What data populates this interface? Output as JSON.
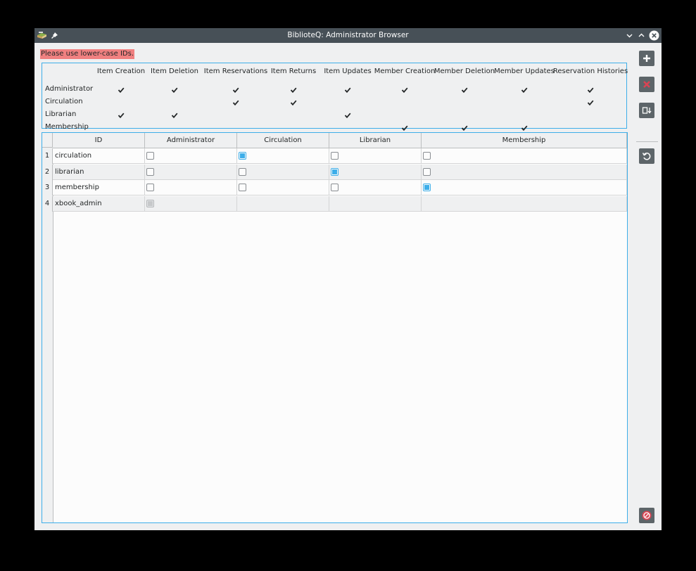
{
  "window": {
    "title": "BiblioteQ: Administrator Browser"
  },
  "warning": {
    "text": "Please use lower-case IDs."
  },
  "permissions": {
    "columns": [
      "Item Creation",
      "Item Deletion",
      "Item Reservations",
      "Item Returns",
      "Item Updates",
      "Member Creation",
      "Member Deletion",
      "Member Updates",
      "Reservation Histories"
    ],
    "rows": [
      {
        "label": "Administrator",
        "checks": [
          true,
          true,
          true,
          true,
          true,
          true,
          true,
          true,
          true
        ]
      },
      {
        "label": "Circulation",
        "checks": [
          false,
          false,
          true,
          true,
          false,
          false,
          false,
          false,
          true
        ]
      },
      {
        "label": "Librarian",
        "checks": [
          true,
          true,
          false,
          false,
          true,
          false,
          false,
          false,
          false
        ]
      },
      {
        "label": "Membership",
        "checks": [
          false,
          false,
          false,
          false,
          false,
          true,
          true,
          true,
          false
        ]
      }
    ]
  },
  "table": {
    "headers": [
      "ID",
      "Administrator",
      "Circulation",
      "Librarian",
      "Membership"
    ],
    "rows": [
      {
        "num": "1",
        "id": "circulation",
        "admin": false,
        "circ": true,
        "lib": false,
        "memb": false,
        "disabled": false
      },
      {
        "num": "2",
        "id": "librarian",
        "admin": false,
        "circ": false,
        "lib": true,
        "memb": false,
        "disabled": false
      },
      {
        "num": "3",
        "id": "membership",
        "admin": false,
        "circ": false,
        "lib": false,
        "memb": true,
        "disabled": false
      },
      {
        "num": "4",
        "id": "xbook_admin",
        "admin": true,
        "circ": null,
        "lib": null,
        "memb": null,
        "disabled": true
      }
    ]
  },
  "icons": {
    "app": "biblioteq-app-icon",
    "pin": "pin-icon",
    "minimize": "chevron-down-icon",
    "maximize": "chevron-up-icon",
    "close": "close-icon",
    "add": "plus-icon",
    "delete": "delete-x-icon",
    "save": "save-icon",
    "reload": "reload-icon",
    "cancel": "cancel-icon"
  },
  "colors": {
    "accent": "#3daee9",
    "warning_bg": "#f08080",
    "delete_red": "#da4453",
    "titlebar": "#475057"
  }
}
